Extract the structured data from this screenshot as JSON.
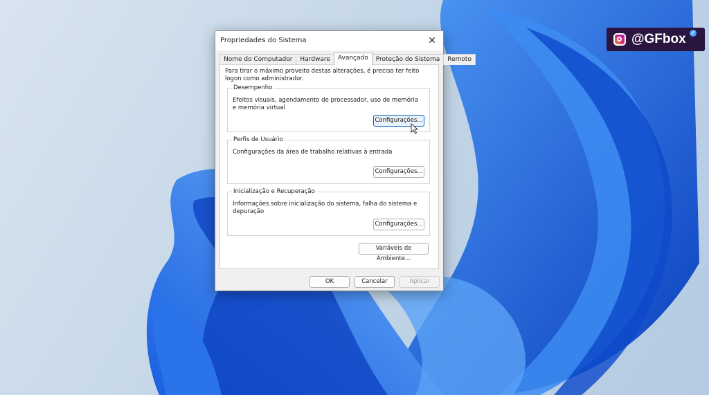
{
  "watermark": {
    "handle": "@GFbox",
    "icon": "instagram-icon",
    "verified_icon": "verified-badge-icon"
  },
  "dialog": {
    "title": "Propriedades do Sistema",
    "close_glyph": "✕",
    "tabs": [
      {
        "label": "Nome do Computador",
        "active": false
      },
      {
        "label": "Hardware",
        "active": false
      },
      {
        "label": "Avançado",
        "active": true
      },
      {
        "label": "Proteção do Sistema",
        "active": false
      },
      {
        "label": "Remoto",
        "active": false
      }
    ],
    "admin_note": "Para tirar o máximo proveito destas alterações, é preciso ter feito logon como administrador.",
    "groups": [
      {
        "label": "Desempenho",
        "description": "Efeitos visuais, agendamento de processador, uso de memória e memória virtual",
        "button": "Configurações..."
      },
      {
        "label": "Perfis de Usuário",
        "description": "Configurações da área de trabalho relativas à entrada",
        "button": "Configurações..."
      },
      {
        "label": "Inicialização e Recuperação",
        "description": "Informações sobre inicialização do sistema, falha do sistema e depuração",
        "button": "Configurações..."
      }
    ],
    "env_button": "Variáveis de Ambiente...",
    "ok_button": "OK",
    "cancel_button": "Cancelar",
    "apply_button": "Aplicar"
  },
  "colors": {
    "accent": "#0067c0",
    "wallpaper_blue": "#1f6fe6",
    "badge_bg": "#2a1540"
  }
}
